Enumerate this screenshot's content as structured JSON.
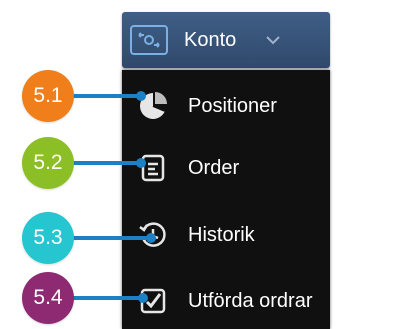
{
  "header": {
    "label": "Konto",
    "icon": "account-icon",
    "chevron": "chevron-down-icon"
  },
  "menu": {
    "items": [
      {
        "label": "Positioner",
        "icon": "pie-chart-icon"
      },
      {
        "label": "Order",
        "icon": "list-icon"
      },
      {
        "label": "Historik",
        "icon": "history-clock-icon"
      },
      {
        "label": "Utförda ordrar",
        "icon": "checkbox-icon"
      }
    ]
  },
  "callouts": [
    {
      "label": "5.1",
      "color": "#f07e1b"
    },
    {
      "label": "5.2",
      "color": "#8cbf26"
    },
    {
      "label": "5.3",
      "color": "#26c6d0"
    },
    {
      "label": "5.4",
      "color": "#8e2a72"
    }
  ],
  "colors": {
    "menu_bg": "#101010",
    "header_bg": "#30496b",
    "leader": "#1d7fc4",
    "icon_accent": "#7ab0e3"
  }
}
